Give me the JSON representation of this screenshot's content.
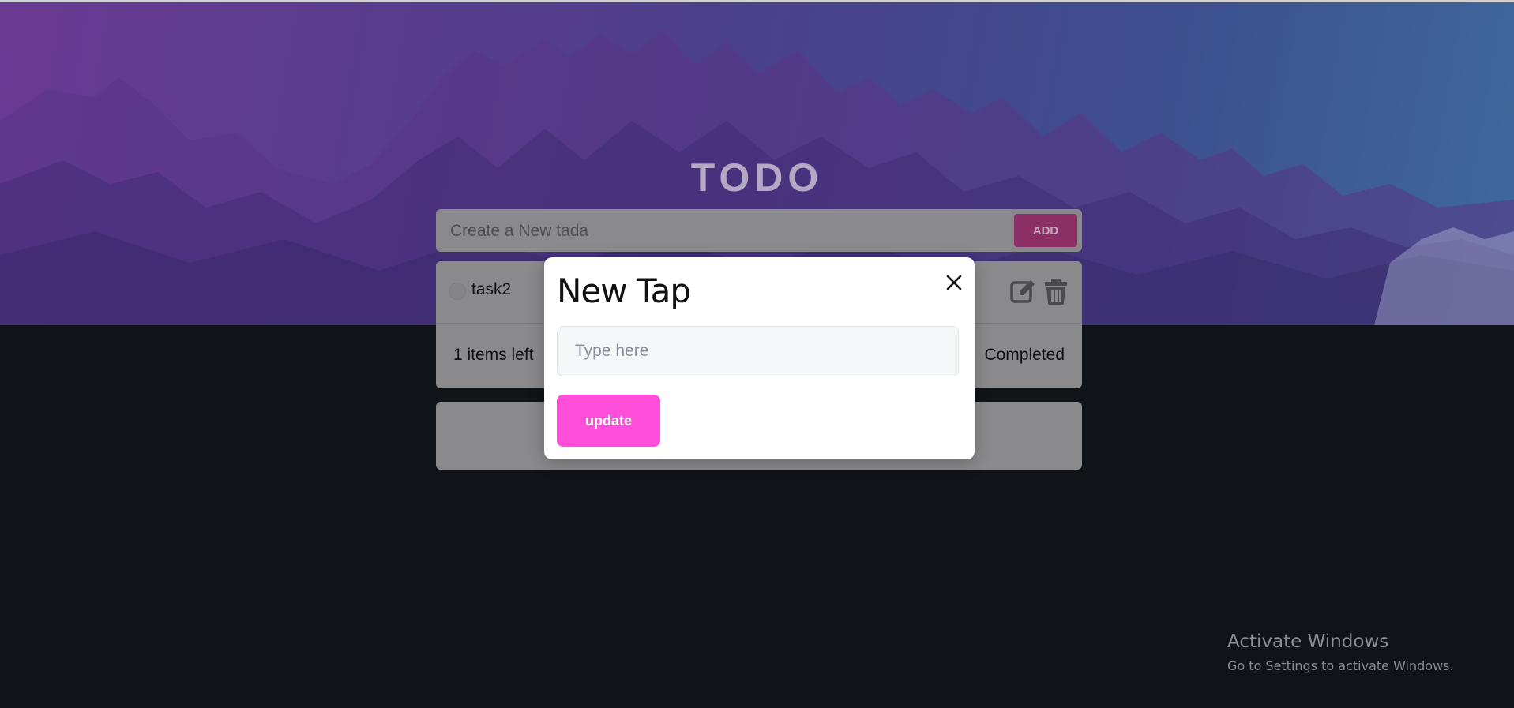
{
  "app": {
    "title": "TODO"
  },
  "add_bar": {
    "placeholder": "Create a New tada",
    "add_label": "ADD"
  },
  "tasks": [
    {
      "text": "task2",
      "completed": false
    }
  ],
  "footer": {
    "items_left": "1 items left",
    "completed_filter": "Completed"
  },
  "modal": {
    "title": "New Tap",
    "input_placeholder": "Type here",
    "update_label": "update",
    "close_icon": "close-icon"
  },
  "icons": {
    "edit": "edit-icon",
    "delete": "trash-icon"
  },
  "watermark": {
    "title": "Activate Windows",
    "subtitle": "Go to Settings to activate Windows."
  },
  "colors": {
    "update_button": "#ff4fda",
    "add_button": "#8c2f66",
    "background_dark": "#101318",
    "hero_gradient_start": "#6a3a93",
    "hero_gradient_end": "#3e6a9c"
  }
}
